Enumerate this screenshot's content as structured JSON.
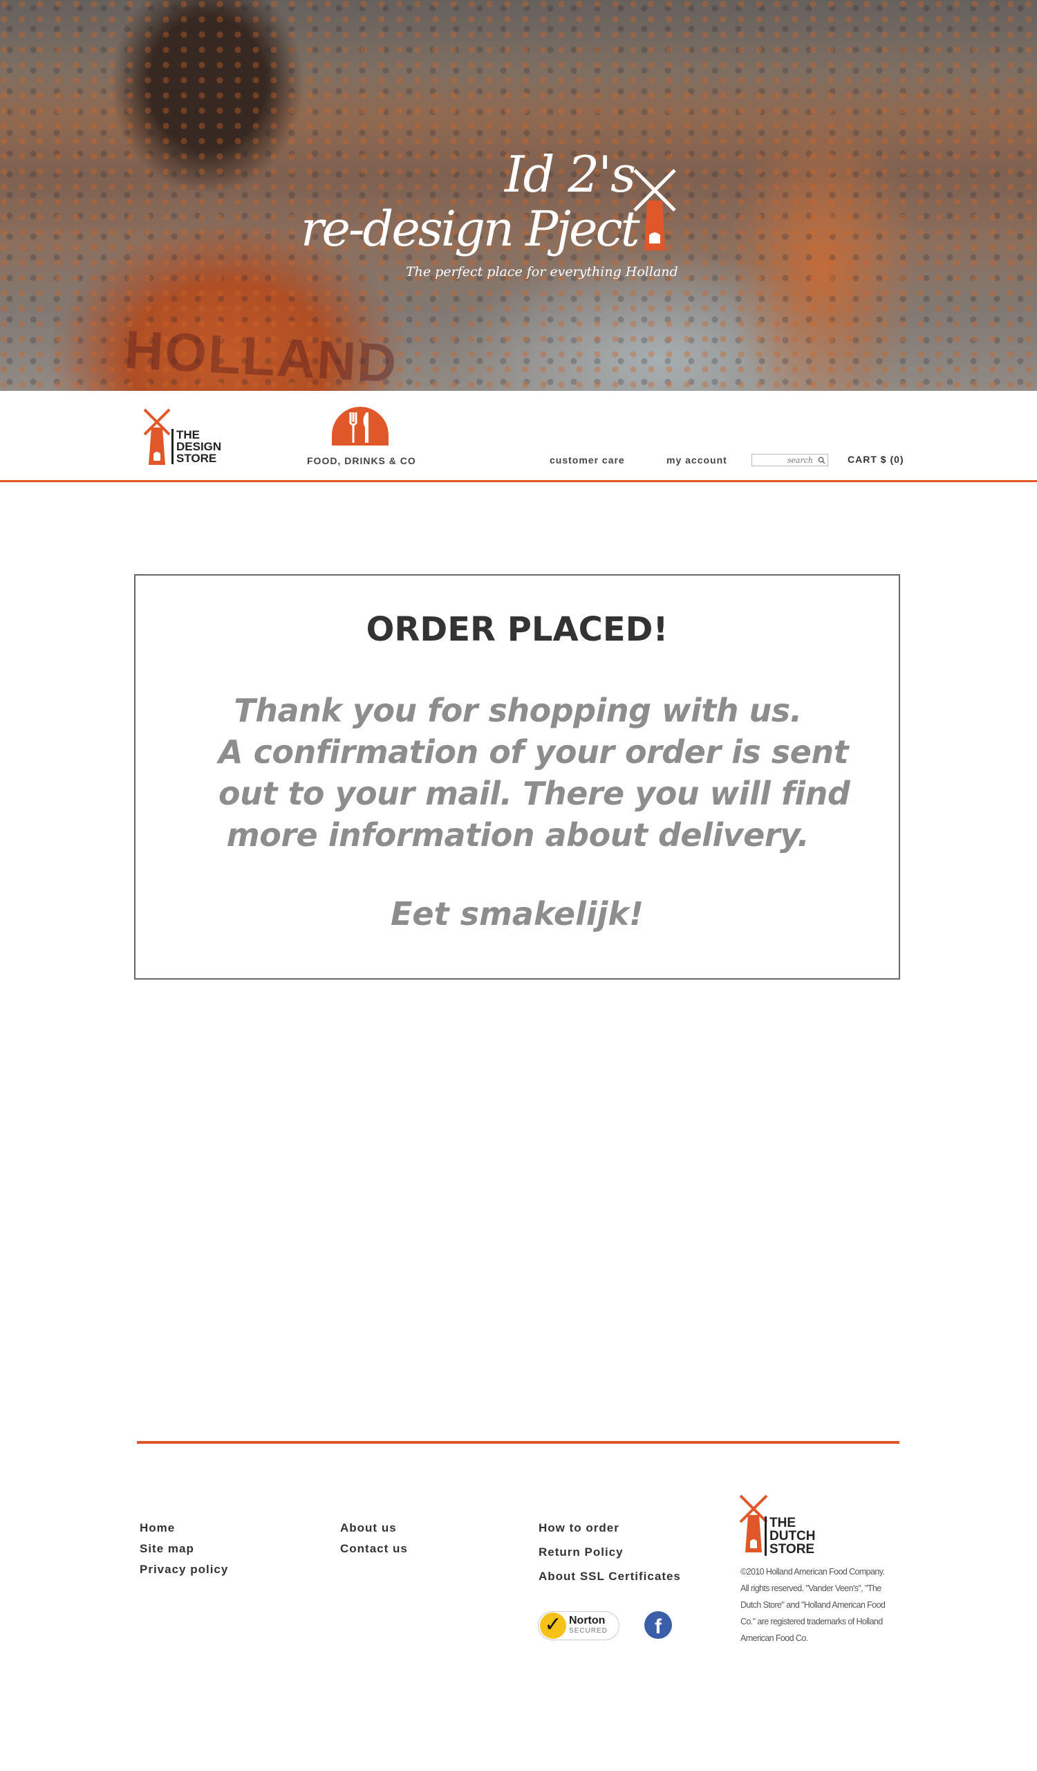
{
  "hero": {
    "title_line1": "Id 2's",
    "title_line2": "re-design Pject",
    "tagline": "The perfect place for everything Holland",
    "shirt_text": "HOLLAND"
  },
  "nav": {
    "logo_text": [
      "THE",
      "DESIGN",
      "STORE"
    ],
    "food_label": "FOOD, DRINKS & CO",
    "customer_care": "customer care",
    "my_account": "my account",
    "search_placeholder": "search",
    "cart": "CART $ (0)"
  },
  "confirmation": {
    "title": "ORDER PLACED!",
    "message_lines": [
      "Thank you for shopping with us.",
      "A confirmation of your order is sent",
      "out to your mail. There you will find",
      "more information about delivery."
    ],
    "signoff": "Eet smakelijk!"
  },
  "footer": {
    "col1": [
      "Home",
      "Site map",
      "Privacy policy"
    ],
    "col2": [
      "About us",
      "Contact us"
    ],
    "col3": [
      "How to order",
      "Return Policy",
      "About SSL Certificates"
    ],
    "norton_name": "Norton",
    "norton_sub": "SECURED",
    "facebook_glyph": "f",
    "logo_text": [
      "THE",
      "DUTCH",
      "STORE"
    ],
    "copyright_lines": [
      "©2010 Holland American Food Company.",
      "All rights reserved. \"Vander Veen's\", \"The",
      "Dutch Store\" and \"Holland American Food",
      "Co.\" are registered trademarks of Holland",
      "American Food Co."
    ]
  },
  "colors": {
    "accent": "#e0582a",
    "text_dark": "#333333",
    "text_grey": "#8d8d8d"
  }
}
